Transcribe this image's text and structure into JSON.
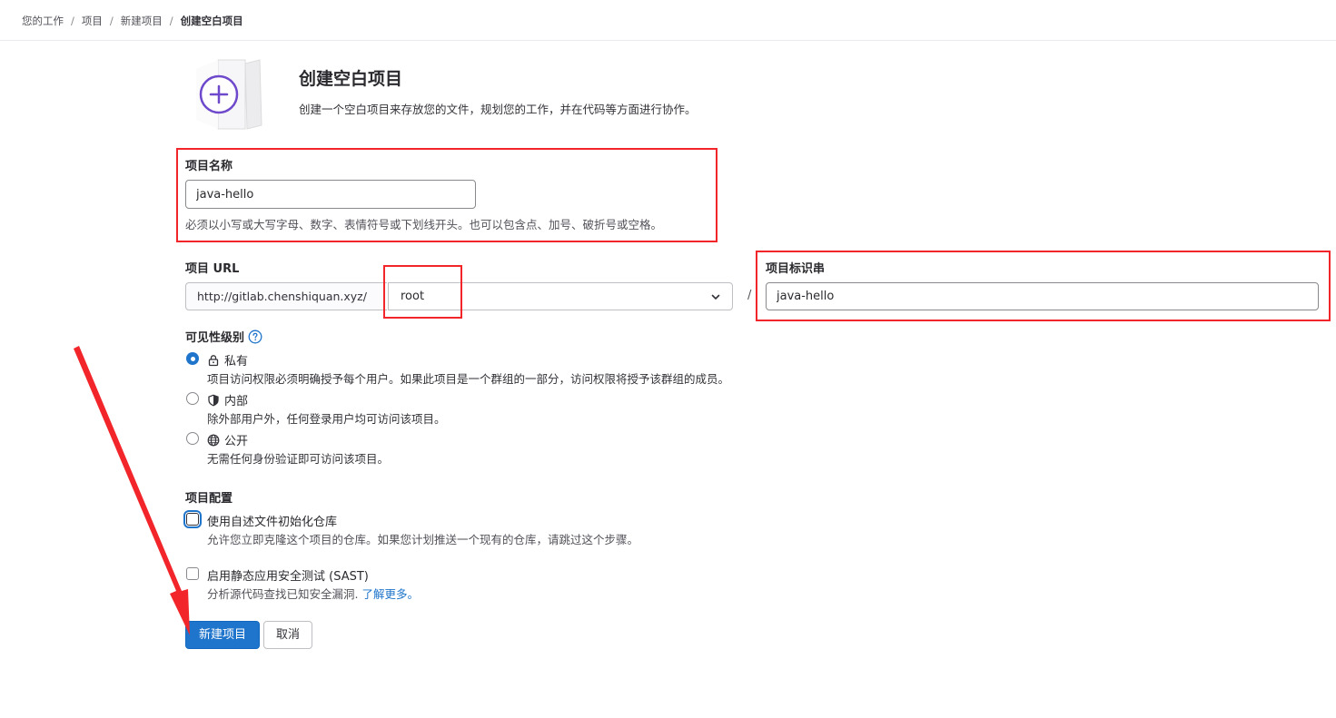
{
  "breadcrumb": {
    "items": [
      "您的工作",
      "项目",
      "新建项目"
    ],
    "current": "创建空白项目",
    "separator": "/"
  },
  "header": {
    "title": "创建空白项目",
    "description": "创建一个空白项目来存放您的文件，规划您的工作，并在代码等方面进行协作。",
    "icon": "plus-circle-icon"
  },
  "project_name": {
    "label": "项目名称",
    "value": "java-hello",
    "help": "必须以小写或大写字母、数字、表情符号或下划线开头。也可以包含点、加号、破折号或空格。"
  },
  "project_url": {
    "label": "项目 URL",
    "prefix": "http://gitlab.chenshiquan.xyz/",
    "namespace": "root",
    "separator": "/"
  },
  "project_slug": {
    "label": "项目标识串",
    "value": "java-hello"
  },
  "visibility": {
    "label": "可见性级别",
    "help_icon": "question-circle-icon",
    "options": [
      {
        "label": "私有",
        "icon": "lock-icon",
        "description": "项目访问权限必须明确授予每个用户。如果此项目是一个群组的一部分，访问权限将授予该群组的成员。",
        "checked": true
      },
      {
        "label": "内部",
        "icon": "shield-icon",
        "description": "除外部用户外，任何登录用户均可访问该项目。",
        "checked": false
      },
      {
        "label": "公开",
        "icon": "globe-icon",
        "description": "无需任何身份验证即可访问该项目。",
        "checked": false
      }
    ]
  },
  "config": {
    "label": "项目配置",
    "options": [
      {
        "label": "使用自述文件初始化仓库",
        "description": "允许您立即克隆这个项目的仓库。如果您计划推送一个现有的仓库，请跳过这个步骤。",
        "checked": false
      },
      {
        "label": "启用静态应用安全测试 (SAST)",
        "description": "分析源代码查找已知安全漏洞.",
        "link": "了解更多。",
        "checked": false
      }
    ]
  },
  "actions": {
    "submit_label": "新建项目",
    "cancel_label": "取消"
  },
  "colors": {
    "primary": "#1f75cb",
    "annotation": "#f2262a",
    "illustration_accent": "#6e49cb"
  }
}
